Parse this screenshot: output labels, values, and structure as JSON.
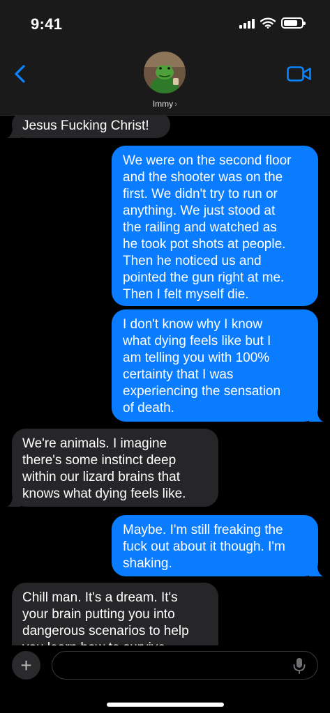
{
  "status_bar": {
    "time": "9:41",
    "icons": [
      "cellular-signal-icon",
      "wifi-icon",
      "battery-icon"
    ],
    "battery_level": 0.8
  },
  "header": {
    "back_icon": "chevron-left-icon",
    "contact_name": "Immy",
    "contact_chevron": "›",
    "video_icon": "video-camera-icon",
    "accent_color": "#0a84ff"
  },
  "messages": [
    {
      "direction": "incoming",
      "text": "Jesus Fucking Christ!"
    },
    {
      "direction": "outgoing",
      "text": "We were on the second floor\nand the shooter was on the\nfirst. We didn't try to run or\nanything. We just stood at\nthe railing and watched as\nhe took pot shots at people.\nThen he noticed us and\npointed the gun right at me.\nThen I felt myself die."
    },
    {
      "direction": "outgoing",
      "text": "I don't know why I know\nwhat dying feels like but I\nam telling you with 100%\ncertainty that I was\nexperiencing the sensation\nof death."
    },
    {
      "direction": "incoming",
      "text": "We're animals. I imagine\nthere's some instinct deep\nwithin our lizard brains that\nknows what dying feels like."
    },
    {
      "direction": "outgoing",
      "text": "Maybe. I'm still freaking the\nfuck out about it though. I'm\nshaking."
    },
    {
      "direction": "incoming",
      "text": "Chill man. It's a dream. It's\nyour brain putting you into\ndangerous scenarios to help\nyou learn how to survive."
    }
  ],
  "colors": {
    "outgoing_bubble": "#0a7cff",
    "incoming_bubble": "#262628",
    "background": "#000000"
  },
  "composer": {
    "plus_label": "+",
    "input_value": "",
    "input_placeholder": "",
    "mic_icon": "microphone-icon"
  }
}
